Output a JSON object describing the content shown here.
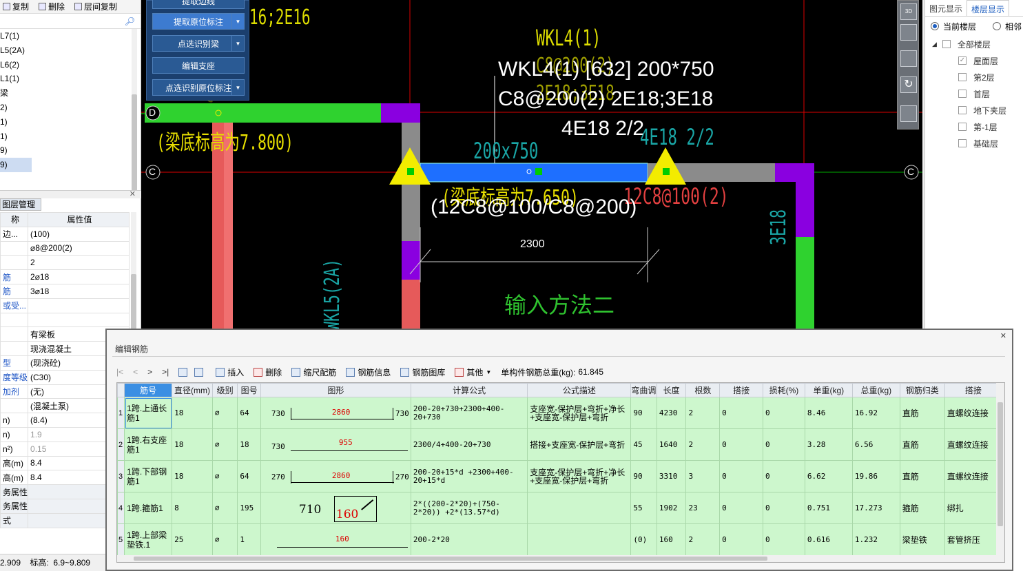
{
  "left_toolbar": {
    "copy": "复制",
    "delete": "删除",
    "floor_copy": "层间复制"
  },
  "member_list": [
    "L7(1)",
    "L5(2A)",
    "L6(2)",
    "L1(1)",
    "梁",
    "2)",
    "1)",
    "1)",
    "9)",
    "9)"
  ],
  "prop_panel": {
    "title": "图层管理",
    "col_name": "称",
    "col_value": "属性值",
    "rows": [
      {
        "k": "边...",
        "v": "(100)",
        "style": ""
      },
      {
        "k": "",
        "v": "⌀8@200(2)",
        "style": ""
      },
      {
        "k": "",
        "v": "2",
        "style": ""
      },
      {
        "k": "筋",
        "v": "2⌀18",
        "style": "blue"
      },
      {
        "k": "筋",
        "v": "3⌀18",
        "style": "blue"
      },
      {
        "k": "或受...",
        "v": "",
        "style": "blue"
      },
      {
        "k": "",
        "v": "",
        "style": ""
      },
      {
        "k": "",
        "v": "有梁板",
        "style": ""
      },
      {
        "k": "",
        "v": "现浇混凝土",
        "style": ""
      },
      {
        "k": "型",
        "v": "(现浇砼)",
        "style": "blue"
      },
      {
        "k": "度等级",
        "v": "(C30)",
        "style": "blue"
      },
      {
        "k": "加剂",
        "v": "(无)",
        "style": "blue"
      },
      {
        "k": "",
        "v": "(混凝土泵)",
        "style": ""
      },
      {
        "k": "n)",
        "v": "(8.4)",
        "style": ""
      },
      {
        "k": "n)",
        "v": "1.9",
        "style": "gray"
      },
      {
        "k": "n²)",
        "v": "0.15",
        "style": "gray"
      },
      {
        "k": "高(m)",
        "v": "8.4",
        "style": ""
      },
      {
        "k": "高(m)",
        "v": "8.4",
        "style": ""
      },
      {
        "k": "务属性",
        "v": "",
        "style": "section"
      },
      {
        "k": "务属性",
        "v": "",
        "style": "section"
      },
      {
        "k": "式",
        "v": "",
        "style": "section"
      }
    ]
  },
  "status_bar": {
    "value": "2.909",
    "elev_label": "标高:",
    "elev_value": "6.9~9.809"
  },
  "tool_panel": {
    "buttons": [
      "提取原位标注",
      "点选识别梁",
      "编辑支座",
      "点选识别原位标注"
    ],
    "top_partial": "提取边线"
  },
  "cad": {
    "axis_d": "D",
    "axis_c_left": "C",
    "axis_c_right": "C",
    "yellow_top_left": "16;2E16",
    "wkl4_yellow": "WKL4(1)",
    "wkl4_yellow2": "C8@200(2)",
    "wkl4_yellow3": "2E18;3E18",
    "beam_label_line1": "WKL4(1) [632] 200*750",
    "beam_label_line2": "C8@200(2) 2E18;3E18",
    "beam_label_line3": "4E18 2/2",
    "beam_cyan_size": "200x750",
    "beam_cyan_bottom": "4E18 2/2",
    "beam_elev_left": "(梁底标高为7.800)",
    "beam_elev_mid": "(梁底标高为7.650)",
    "stirrup_red": "12C8@100(2)",
    "stirrup_white": "(12C8@100/C8@200)",
    "vertical_left": "WKL5(2A)",
    "vertical_right": "3E18",
    "dimension": "2300",
    "method_label": "输入方法二",
    "partial_left_top": "C8@200"
  },
  "view_tools": {
    "top_label": "3D"
  },
  "right_panel": {
    "tabs": [
      "图元显示",
      "楼层显示"
    ],
    "radio_current": "当前楼层",
    "radio_adjacent": "相邻",
    "all_floors": "全部楼层",
    "floors": [
      {
        "label": "屋面层",
        "checked": true
      },
      {
        "label": "第2层",
        "checked": false
      },
      {
        "label": "首层",
        "checked": false
      },
      {
        "label": "地下夹层",
        "checked": false
      },
      {
        "label": "第-1层",
        "checked": false
      },
      {
        "label": "基础层",
        "checked": false
      }
    ]
  },
  "rebar_dialog": {
    "title": "编辑钢筋",
    "toolbar": {
      "insert": "插入",
      "delete": "删除",
      "scale": "缩尺配筋",
      "info": "钢筋信息",
      "library": "钢筋图库",
      "other": "其他",
      "total_weight_label": "单构件钢筋总重(kg):",
      "total_weight_value": "61.845"
    },
    "columns": [
      "筋号",
      "直径(mm)",
      "级别",
      "图号",
      "图形",
      "计算公式",
      "公式描述",
      "弯曲调整",
      "长度",
      "根数",
      "搭接",
      "损耗(%)",
      "单重(kg)",
      "总重(kg)",
      "钢筋归类",
      "搭接"
    ],
    "rows": [
      {
        "idx": "1",
        "name": "1跨.上通长筋1",
        "dia": "18",
        "grade": "⌀",
        "fig": "64",
        "shape_left": "730",
        "shape_mid": "2860",
        "shape_right": "730",
        "formula": "200-20+730+2300+400-20+730",
        "desc": "支座宽-保护层+弯折+净长+支座宽-保护层+弯折",
        "bend": "90",
        "length": "4230",
        "count": "2",
        "lap": "0",
        "loss": "0",
        "unit_w": "8.46",
        "total_w": "16.92",
        "category": "直筋",
        "lap_type": "直螺纹连接"
      },
      {
        "idx": "2",
        "name": "1跨.右支座筋1",
        "dia": "18",
        "grade": "⌀",
        "fig": "18",
        "shape_left": "730",
        "shape_mid": "955",
        "shape_right": "",
        "formula": "2300/4+400-20+730",
        "desc": "搭接+支座宽-保护层+弯折",
        "bend": "45",
        "length": "1640",
        "count": "2",
        "lap": "0",
        "loss": "0",
        "unit_w": "3.28",
        "total_w": "6.56",
        "category": "直筋",
        "lap_type": "直螺纹连接"
      },
      {
        "idx": "3",
        "name": "1跨.下部钢筋1",
        "dia": "18",
        "grade": "⌀",
        "fig": "64",
        "shape_left": "270",
        "shape_mid": "2860",
        "shape_right": "270",
        "formula": "200-20+15*d +2300+400-20+15*d",
        "desc": "支座宽-保护层+弯折+净长+支座宽-保护层+弯折",
        "bend": "90",
        "length": "3310",
        "count": "3",
        "lap": "0",
        "loss": "0",
        "unit_w": "6.62",
        "total_w": "19.86",
        "category": "直筋",
        "lap_type": "直螺纹连接"
      },
      {
        "idx": "4",
        "name": "1跨.箍筋1",
        "dia": "8",
        "grade": "⌀",
        "fig": "195",
        "shape_left": "710",
        "shape_mid": "160",
        "shape_right": "",
        "formula": "2*((200-2*20)+(750-2*20)) +2*(13.57*d)",
        "desc": "",
        "bend": "55",
        "length": "1902",
        "count": "23",
        "lap": "0",
        "loss": "0",
        "unit_w": "0.751",
        "total_w": "17.273",
        "category": "箍筋",
        "lap_type": "绑扎"
      },
      {
        "idx": "5",
        "name": "1跨.上部梁垫铁.1",
        "dia": "25",
        "grade": "⌀",
        "fig": "1",
        "shape_left": "",
        "shape_mid": "160",
        "shape_right": "",
        "formula": "200-2*20",
        "desc": "",
        "bend": "(0)",
        "length": "160",
        "count": "2",
        "lap": "0",
        "loss": "0",
        "unit_w": "0.616",
        "total_w": "1.232",
        "category": "梁垫铁",
        "lap_type": "套管挤压"
      }
    ]
  }
}
